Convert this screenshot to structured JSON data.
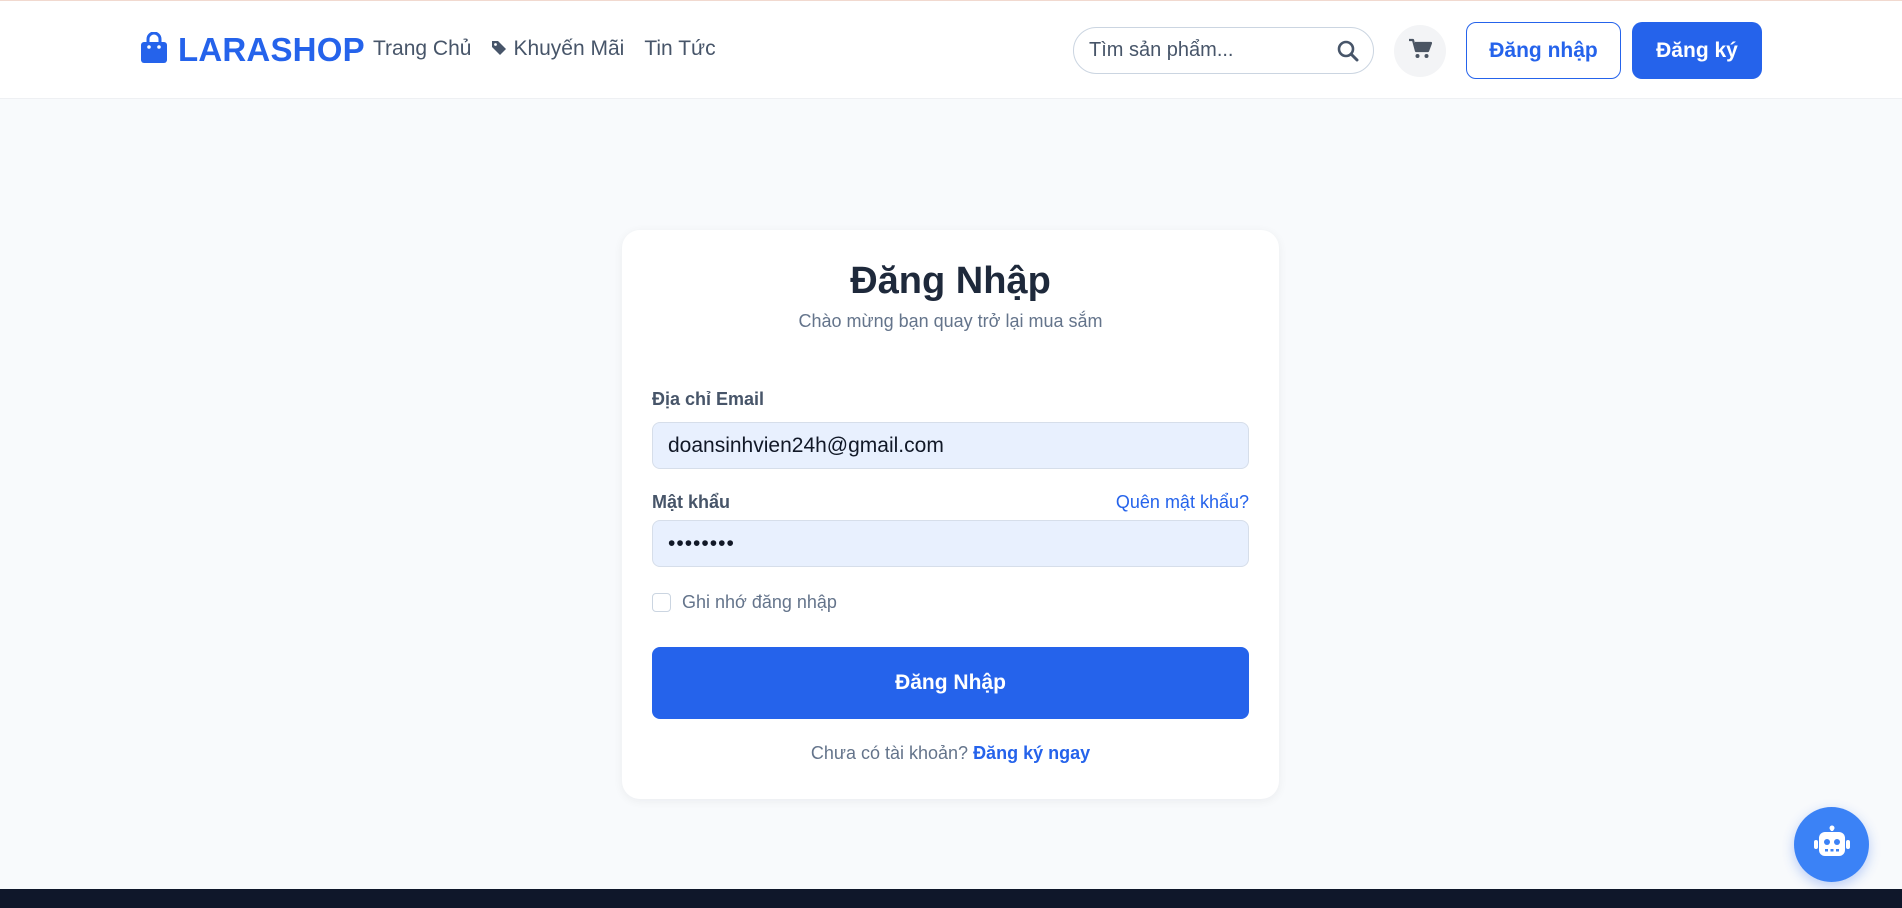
{
  "brand": {
    "name": "LARASHOP",
    "color": "#2563eb"
  },
  "nav": [
    {
      "label": "Trang Chủ"
    },
    {
      "label": "Khuyến Mãi",
      "icon": "tag-icon"
    },
    {
      "label": "Tin Tức"
    }
  ],
  "search": {
    "placeholder": "Tìm sản phẩm...",
    "value": ""
  },
  "header_actions": {
    "login": "Đăng nhập",
    "register": "Đăng ký"
  },
  "form": {
    "title": "Đăng Nhập",
    "subtitle": "Chào mừng bạn quay trở lại mua sắm",
    "email_label": "Địa chỉ Email",
    "email_value": "doansinhvien24h@gmail.com",
    "password_label": "Mật khẩu",
    "forgot": "Quên mật khẩu?",
    "password_mask": "••••••••",
    "remember": "Ghi nhớ đăng nhập",
    "remember_checked": false,
    "submit": "Đăng Nhập",
    "no_account": "Chưa có tài khoản?",
    "signup_link": "Đăng ký ngay"
  },
  "icons": {
    "logo": "shopping-bag-icon",
    "search": "search-icon",
    "cart": "cart-icon",
    "chatbot": "robot-icon"
  }
}
